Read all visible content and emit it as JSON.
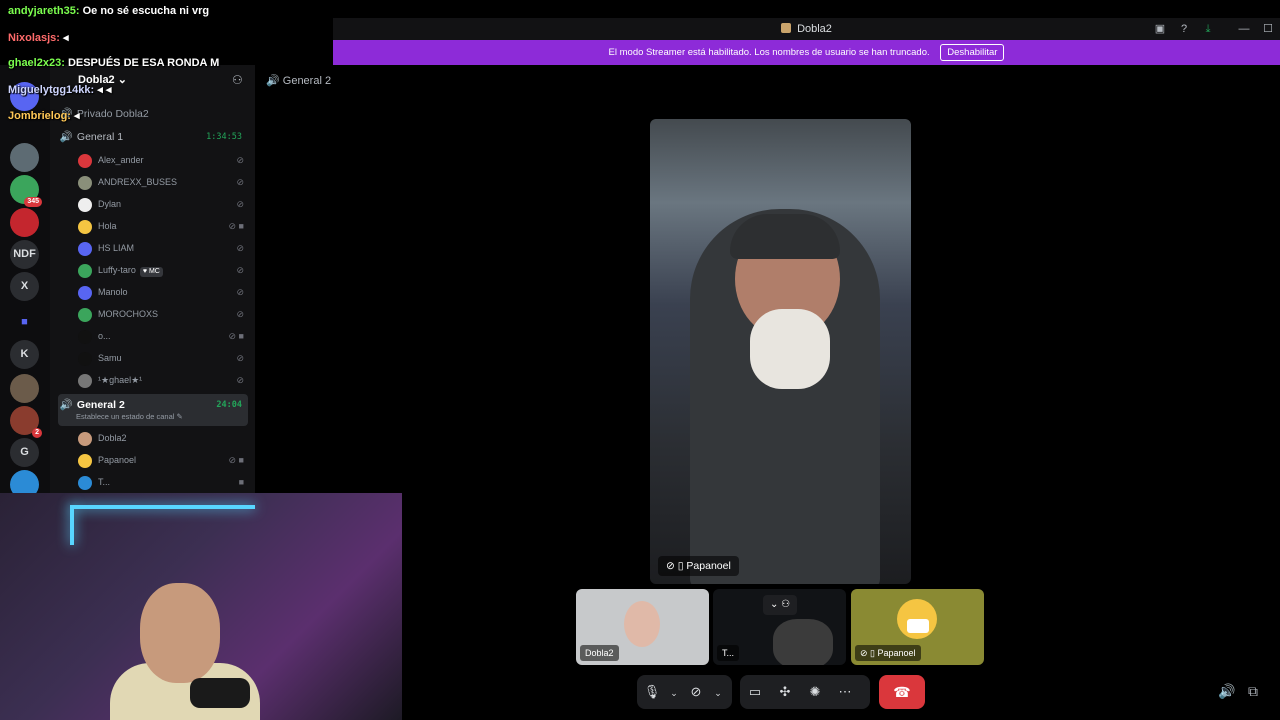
{
  "window": {
    "title": "Dobla2"
  },
  "banner": {
    "text": "El modo Streamer está habilitado. Los nombres de usuario se han truncado.",
    "button": "Deshabilitar"
  },
  "server_rail": [
    "NDF",
    "X",
    "K",
    "G"
  ],
  "server_badges": [
    "345",
    "2"
  ],
  "server": {
    "name": "Dobla2"
  },
  "channels": [
    {
      "name": "Privado Dobla2"
    },
    {
      "name": "General 1",
      "timer": "1:34:53"
    },
    {
      "name": "General 2",
      "timer": "24:04",
      "status": "Establece un estado de canal"
    }
  ],
  "general1_users": [
    "Alex_ander",
    "ANDREXX_BUSES",
    "Dylan",
    "Hola",
    "HS LIAM",
    "Luffy-taro",
    "Manolo",
    "MOROCHOXS",
    "o...",
    "Samu",
    "¹★ghael★¹"
  ],
  "general1_badge": "MC",
  "general2_users": [
    "Dobla2",
    "Papanoel",
    "T..."
  ],
  "main": {
    "channel": "General 2"
  },
  "video": {
    "main_label": "Papanoel",
    "tile1_label": "Dobla2",
    "tile2_label": "T...",
    "tile3_label": "Papanoel"
  },
  "chat": [
    {
      "user": "andyjareth35:",
      "text": "Oe no sé escucha ni vrg",
      "color": "#7cff4f"
    },
    {
      "user": "Nixolasjs:",
      "text": "",
      "color": "#ff6b6b"
    },
    {
      "user": "ghael2x23:",
      "text": "DESPUÉS DE ESA RONDA M",
      "color": "#7cff4f"
    },
    {
      "user": "Miguelytgg14kk:",
      "text": "",
      "color": "#cfd6ff"
    },
    {
      "user": "Jombrielog:",
      "text": "",
      "color": "#ffc857"
    }
  ]
}
